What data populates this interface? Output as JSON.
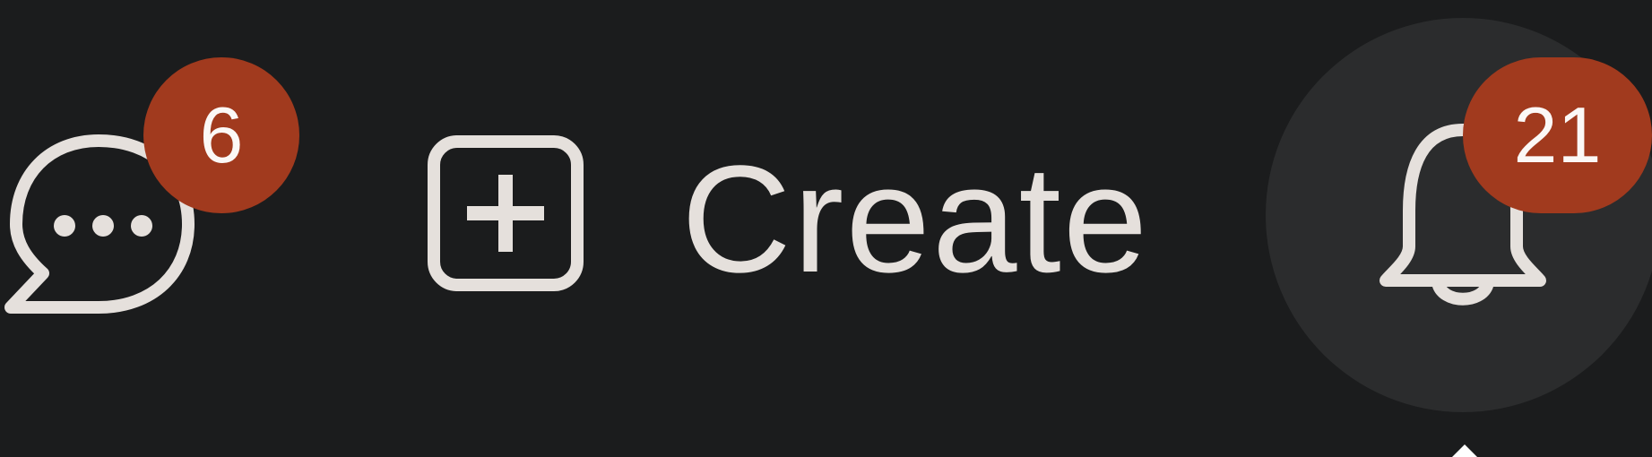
{
  "header": {
    "chat": {
      "icon": "chat-bubble-icon",
      "badge_count": "6"
    },
    "create": {
      "icon": "plus-square-icon",
      "label": "Create"
    },
    "notifications": {
      "icon": "bell-icon",
      "badge_count": "21"
    }
  },
  "colors": {
    "background": "#1b1c1d",
    "icon": "#e5e0dc",
    "badge": "#a13a1e",
    "badge_text": "#fbf8f6",
    "hover_circle": "#2b2c2d"
  }
}
